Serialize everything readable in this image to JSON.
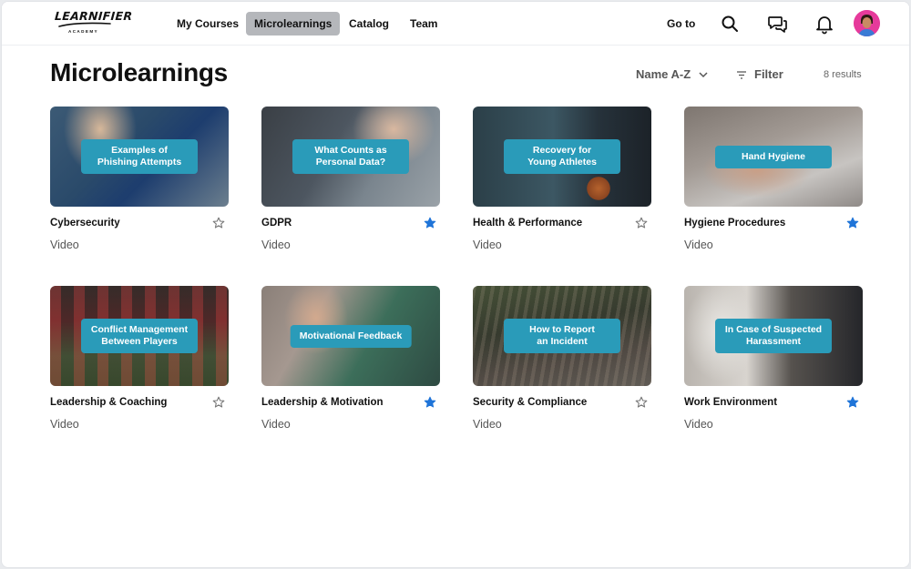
{
  "brand": {
    "name": "LEARNIFIER",
    "sub": "ACADEMY"
  },
  "nav": {
    "items": [
      {
        "label": "My Courses",
        "active": false
      },
      {
        "label": "Microlearnings",
        "active": true
      },
      {
        "label": "Catalog",
        "active": false
      },
      {
        "label": "Team",
        "active": false
      }
    ],
    "goto_label": "Go to",
    "icons": [
      "search-icon",
      "chat-icon",
      "bell-icon",
      "avatar"
    ]
  },
  "page": {
    "title": "Microlearnings",
    "sort_label": "Name A-Z",
    "filter_label": "Filter",
    "results": "8 results"
  },
  "colors": {
    "accent": "#2a9bb9",
    "star_filled": "#1f74d8",
    "nav_active": "#b5b7bb"
  },
  "cards": [
    {
      "overlay": "Examples of\nPhishing Attempts",
      "title": "Cybersecurity",
      "type": "Video",
      "favorite": false
    },
    {
      "overlay": "What Counts as\nPersonal Data?",
      "title": "GDPR",
      "type": "Video",
      "favorite": true
    },
    {
      "overlay": "Recovery for\nYoung Athletes",
      "title": "Health & Performance",
      "type": "Video",
      "favorite": false
    },
    {
      "overlay": "Hand Hygiene",
      "title": "Hygiene Procedures",
      "type": "Video",
      "favorite": true
    },
    {
      "overlay": "Conflict Management\nBetween Players",
      "title": "Leadership & Coaching",
      "type": "Video",
      "favorite": false
    },
    {
      "overlay": "Motivational Feedback",
      "title": "Leadership & Motivation",
      "type": "Video",
      "favorite": true
    },
    {
      "overlay": "How to Report\nan Incident",
      "title": "Security & Compliance",
      "type": "Video",
      "favorite": false
    },
    {
      "overlay": "In Case of Suspected\nHarassment",
      "title": "Work Environment",
      "type": "Video",
      "favorite": true
    }
  ]
}
